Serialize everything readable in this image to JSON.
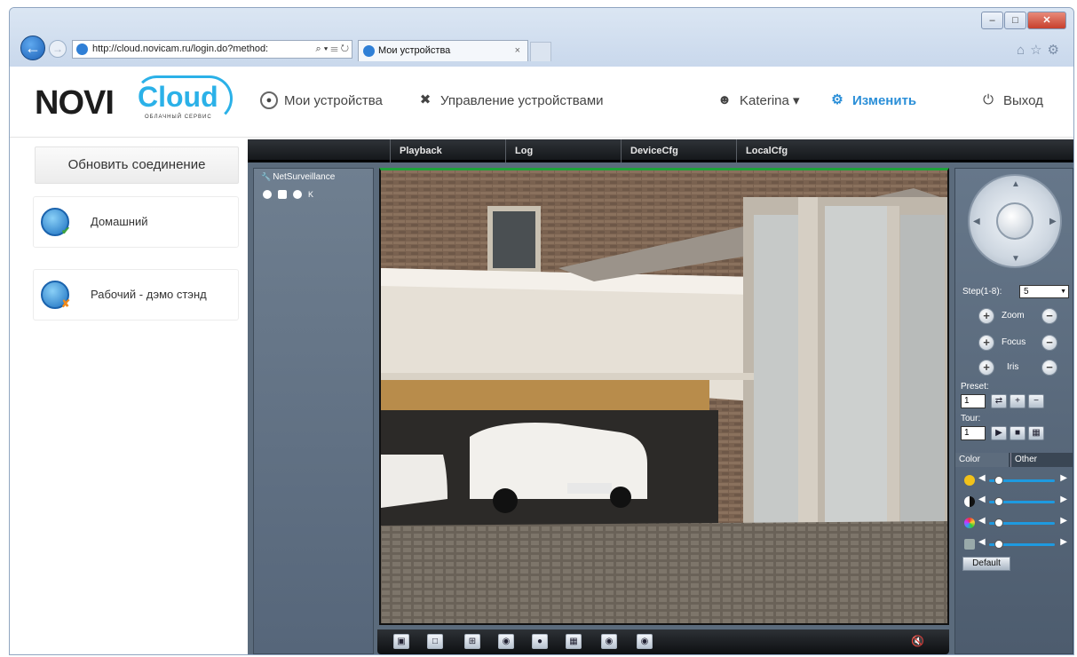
{
  "browser": {
    "address_url": "http://cloud.novicam.ru/login.do?method:",
    "address_controls": "⌕ ▾ ☰ ↻",
    "tab_title": "Мои устройства",
    "tab_close": "×",
    "window_buttons": {
      "minimize": "–",
      "maximize": "□",
      "close": "✕"
    },
    "toolbar_icons": "⌂☆⚙"
  },
  "header": {
    "logo_novi": "NOVI",
    "logo_cloud": "Cloud",
    "logo_sub": "ОБЛАЧНЫЙ СЕРВИС",
    "nav": {
      "devices": "Мои устройства",
      "manage": "Управление устройствами",
      "user": "Katerina ▾",
      "change": "Изменить",
      "exit": "Выход"
    }
  },
  "sidebar": {
    "refresh_label": "Обновить соединение",
    "devices": [
      {
        "name": "Домашний",
        "status": "online"
      },
      {
        "name": "Рабочий - дэмо стэнд",
        "status": "offline"
      }
    ]
  },
  "app": {
    "tabs": [
      "Playback",
      "Log",
      "DeviceCfg",
      "LocalCfg"
    ],
    "tree_root": "NetSurveillance",
    "tree_k": "K",
    "ptz": {
      "step_label": "Step(1-8):",
      "step_value": "5",
      "zoom": "Zoom",
      "focus": "Focus",
      "iris": "Iris",
      "preset_label": "Preset:",
      "preset_value": "1",
      "tour_label": "Tour:",
      "tour_value": "1",
      "color_tab": "Color",
      "other_tab": "Other",
      "default_btn": "Default"
    }
  },
  "colors": {
    "accent": "#2b8fd8",
    "cloud_blue": "#2bb1e8",
    "active_green": "#1fa23a"
  }
}
